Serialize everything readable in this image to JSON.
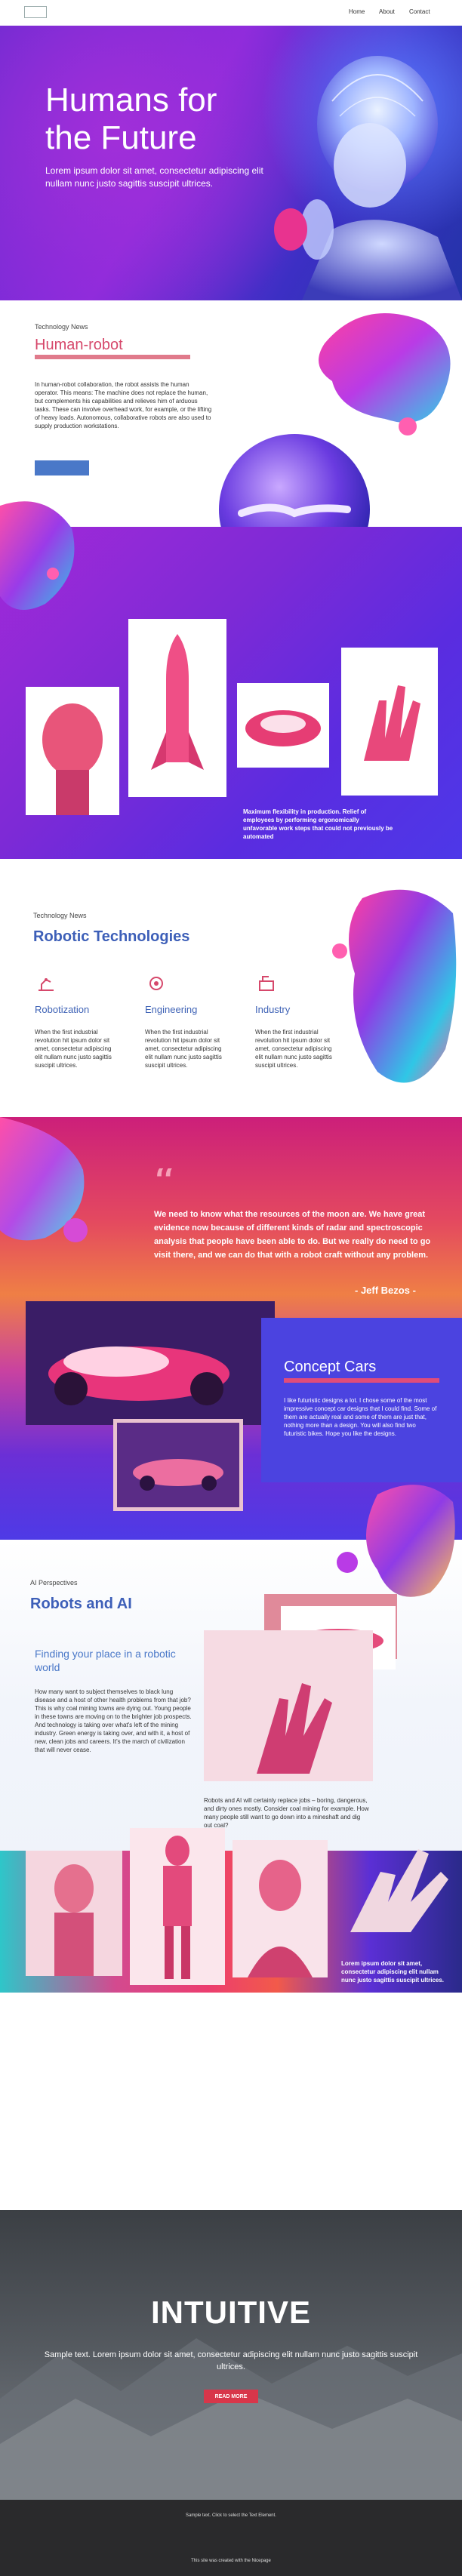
{
  "nav": {
    "home": "Home",
    "about": "About",
    "contact": "Contact"
  },
  "hero": {
    "title_line1": "Humans for",
    "title_line2": "the Future",
    "subtitle": "Lorem ipsum dolor sit amet, consectetur adipiscing elit nullam nunc justo sagittis suscipit ultrices."
  },
  "human_robot": {
    "small": "Technology News",
    "title": "Human-robot",
    "text": "In human-robot collaboration, the robot assists the human operator. This means: The machine does not replace the human, but complements his capabilities and relieves him of arduous tasks. These can involve overhead work, for example, or the lifting of heavy loads. Autonomous, collaborative robots are also used to supply production workstations."
  },
  "band1": {
    "caption": "Maximum flexibility in production. Relief of employees by performing ergonomically unfavorable work steps that could not previously be automated"
  },
  "robotic": {
    "small": "Technology News",
    "title": "Robotic Technologies",
    "features": [
      {
        "title": "Robotization",
        "text": "When the first industrial revolution hit ipsum dolor sit amet, consectetur adipiscing elit nullam nunc justo sagittis suscipit ultrices."
      },
      {
        "title": "Engineering",
        "text": "When the first industrial revolution hit ipsum dolor sit amet, consectetur adipiscing elit nullam nunc justo sagittis suscipit ultrices."
      },
      {
        "title": "Industry",
        "text": "When the first industrial revolution hit ipsum dolor sit amet, consectetur adipiscing elit nullam nunc justo sagittis suscipit ultrices."
      }
    ]
  },
  "quote": {
    "text": "We need to know what the resources of the moon are. We have great evidence now because of different kinds of radar and spectroscopic analysis that people have been able to do. But we really do need to go visit there, and we can do that with a robot craft without any problem.",
    "author": "- Jeff Bezos -"
  },
  "concept": {
    "title": "Concept Cars",
    "text": "I like futuristic designs a lot. I chose some of the most impressive concept car designs that I could find. Some of them are actually real and some of them are just that, nothing more than a design. You will also find two futuristic bikes. Hope you like the designs."
  },
  "ai": {
    "small": "AI Perspectives",
    "title": "Robots and AI",
    "subtitle": "Finding your place in a robotic world",
    "text1": "How many want to subject themselves to black lung disease and a host of other health problems from that job? This is why coal mining towns are dying out. Young people in these towns are moving on to the brighter job prospects. And technology is taking over what's left of the mining industry. Green energy is taking over, and with it, a host of new, clean jobs and careers. It's the march of civilization that will never cease.",
    "text2": "Robots and AI will certainly replace jobs – boring, dangerous, and dirty ones mostly. Consider coal mining for example. How many people still want to go down into a mineshaft and dig out coal?",
    "strip_caption": "Lorem ipsum dolor sit amet, consectetur adipiscing elit nullam nunc justo sagittis suscipit ultrices."
  },
  "intuitive": {
    "title": "INTUITIVE",
    "text": "Sample text. Lorem ipsum dolor sit amet, consectetur adipiscing elit nullam nunc justo sagittis suscipit ultrices.",
    "button": "READ MORE"
  },
  "footer": {
    "line1": "Sample text. Click to select the Text Element.",
    "line2": "This site was created with the Nicepage"
  },
  "colors": {
    "accent_pink": "#d6486b",
    "accent_blue": "#3d5fb8",
    "purple": "#7d2ad6",
    "button_red": "#d8364a"
  }
}
